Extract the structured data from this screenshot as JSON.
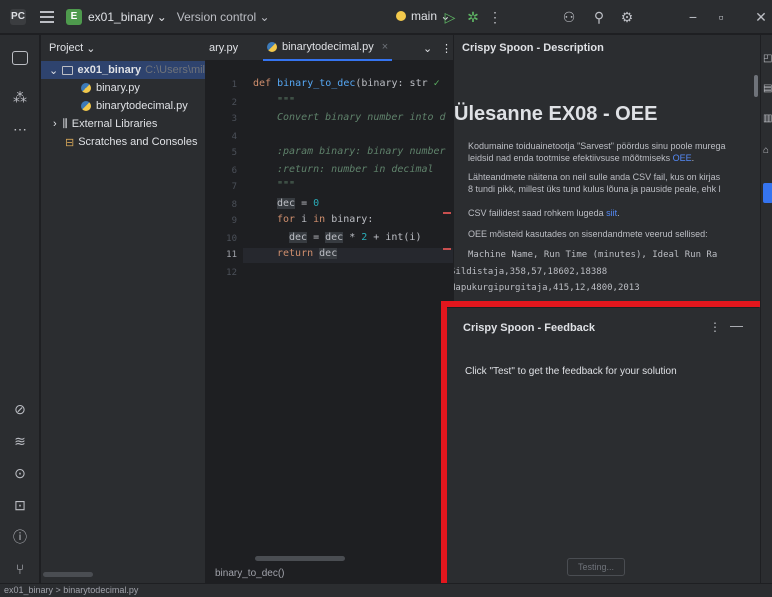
{
  "titlebar": {
    "logo": "PC",
    "project_badge": "E",
    "project_name": "ex01_binary",
    "version_control": "Version control",
    "branch": "main",
    "icons": [
      "run-icon",
      "debug-icon",
      "more-icon",
      "account-icon",
      "search-icon",
      "settings-icon",
      "minimize-icon",
      "maximize-icon",
      "close-icon"
    ]
  },
  "project_panel": {
    "header": "Project",
    "items": [
      {
        "label": "ex01_binary",
        "hint": "C:\\Users\\mil",
        "kind": "folder"
      },
      {
        "label": "binary.py",
        "kind": "python"
      },
      {
        "label": "binarytodecimal.py",
        "kind": "python"
      },
      {
        "label": "External Libraries",
        "kind": "library"
      },
      {
        "label": "Scratches and Consoles",
        "kind": "scratch"
      }
    ]
  },
  "editor": {
    "tabs": [
      {
        "label": "ary.py"
      },
      {
        "label": "binarytodecimal.py",
        "close": "×"
      }
    ],
    "line_numbers": [
      "1",
      "2",
      "3",
      "4",
      "5",
      "6",
      "7",
      "8",
      "9",
      "10",
      "11",
      "12"
    ],
    "current_line": "11",
    "code": {
      "l1_def": "def ",
      "l1_fn": "binary_to_dec",
      "l1_rest": "(binary: str",
      "l2": "\"\"\"",
      "l3": "Convert binary number into d",
      "l5": ":param binary: binary number",
      "l6": ":return: number in decimal",
      "l7": "\"\"\"",
      "l8_var": "dec",
      "l8_rest": " = ",
      "l8_num": "0",
      "l9_for": "for ",
      "l9_i": "i ",
      "l9_in": "in ",
      "l9_rest": "binary:",
      "l10_var": "dec",
      "l10_mid": " = ",
      "l10_var2": "dec",
      "l10_op": " * ",
      "l10_num": "2",
      "l10_rest": " + int(i)",
      "l11_ret": "return ",
      "l11_var": "dec"
    },
    "breadcrumb": "binary_to_dec()"
  },
  "description": {
    "header": "Crispy Spoon - Description",
    "title": "Ülesanne EX08 - OEE",
    "p1a": "Kodumaine toiduainetootja \"Sarvest\" pöördus sinu poole murega",
    "p1b": "leidsid nad enda tootmise efektiivsuse mõõtmiseks",
    "p1_link": "OEE",
    "p2a": "Lähteandmete näitena on neil sulle anda CSV fail, kus on kirjas",
    "p2b": "8 tundi pikk, millest üks tund kulus lõuna ja pauside peale, ehk l",
    "p3": "CSV failidest saad rohkem lugeda",
    "p3_link": "siit",
    "p4": "OEE mõisteid kasutades on sisendandmete veerud sellised:",
    "csv_header": "Machine Name, Run Time (minutes), Ideal Run Ra",
    "csv_rows": [
      "Sildistaja,358,57,18602,18388",
      "Hapukurgipurgitaja,415,12,4800,2013"
    ]
  },
  "feedback": {
    "header": "Crispy Spoon - Feedback",
    "message": "Click \"Test\" to get the feedback for your solution",
    "button": "Testing..."
  },
  "statusbar": {
    "path": "ex01_binary  >  binarytodecimal.py"
  },
  "colors": {
    "highlight": "#e3161d",
    "accent": "#3574f0"
  }
}
